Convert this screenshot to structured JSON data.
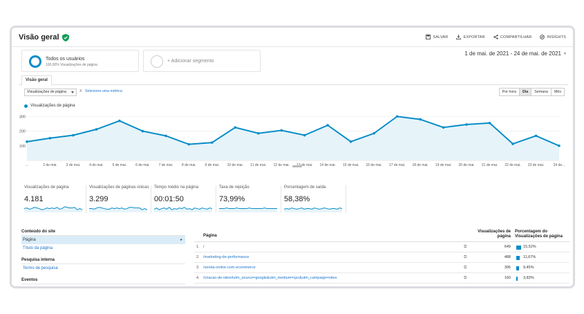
{
  "header": {
    "title": "Visão geral",
    "actions": [
      {
        "label": "SALVAR",
        "icon": "save-icon"
      },
      {
        "label": "EXPORTAR",
        "icon": "download-icon"
      },
      {
        "label": "COMPARTILHAR",
        "icon": "share-icon"
      },
      {
        "label": "INSIGHTS",
        "icon": "insights-icon"
      }
    ]
  },
  "segments": {
    "primary_name": "Todos os usuários",
    "primary_desc": "100,00% Visualizações de página",
    "add_label": "+ Adicionar segmento"
  },
  "date_range": "1 de mai. de 2021 - 24 de mai. de 2021",
  "tabs": [
    "Visão geral"
  ],
  "controls": {
    "metric": "Visualizações de página",
    "vs": "X",
    "select_metric": "Selecione uma métrica",
    "periods": [
      "Por hora",
      "Dia",
      "Semana",
      "Mês"
    ],
    "active_period": "Dia"
  },
  "colors": {
    "accent": "#058dc7",
    "fill": "#e6f3f9",
    "link": "#1a73c8"
  },
  "chart_data": {
    "type": "area",
    "series": [
      {
        "name": "Visualizações de página",
        "values": [
          128,
          152,
          172,
          212,
          270,
          200,
          168,
          110,
          122,
          225,
          185,
          205,
          172,
          240,
          128,
          185,
          300,
          280,
          225,
          245,
          255,
          113,
          168,
          100
        ]
      }
    ],
    "x": [
      "...",
      "2 de mai.",
      "3 de mai.",
      "4 de mai.",
      "5 de mai.",
      "6 de mai.",
      "7 de mai.",
      "8 de mai.",
      "9 de mai.",
      "10 de mai.",
      "11 de mai.",
      "12 de mai.",
      "13 de mai.",
      "14 de mai.",
      "15 de mai.",
      "16 de mai.",
      "17 de mai.",
      "18 de mai.",
      "19 de mai.",
      "20 de mai.",
      "21 de mai.",
      "22 de mai.",
      "23 de mai.",
      "24 de..."
    ],
    "yticks": [
      100,
      200,
      300
    ],
    "ylim": [
      0,
      330
    ],
    "grid": true
  },
  "kpis": [
    {
      "label": "Visualizações de página",
      "value": "4.181",
      "spark": [
        5,
        6,
        4,
        5,
        7,
        6,
        5,
        3,
        4,
        6,
        5,
        6,
        5,
        7,
        4,
        5,
        8,
        7,
        6,
        6,
        7,
        3,
        5,
        3
      ]
    },
    {
      "label": "Visualizações de páginas únicas",
      "value": "3.299",
      "spark": [
        5,
        5,
        4,
        6,
        7,
        6,
        5,
        4,
        4,
        6,
        5,
        6,
        5,
        6,
        4,
        5,
        7,
        7,
        6,
        6,
        6,
        3,
        5,
        3
      ]
    },
    {
      "label": "Tempo médio na página",
      "value": "00:01:50",
      "spark": [
        4,
        6,
        3,
        5,
        6,
        4,
        7,
        3,
        5,
        4,
        6,
        5,
        7,
        4,
        5,
        3,
        6,
        5,
        4,
        6,
        5,
        4,
        6,
        5
      ]
    },
    {
      "label": "Taxa de rejeição",
      "value": "73,99%",
      "spark": [
        5,
        5,
        5,
        6,
        5,
        5,
        5,
        6,
        5,
        5,
        5,
        5,
        6,
        5,
        5,
        5,
        5,
        5,
        6,
        5,
        5,
        5,
        5,
        5
      ]
    },
    {
      "label": "Porcentagem de saída",
      "value": "58,38%",
      "spark": [
        4,
        5,
        4,
        6,
        5,
        4,
        5,
        6,
        4,
        5,
        5,
        4,
        6,
        5,
        4,
        5,
        6,
        5,
        4,
        5,
        5,
        4,
        6,
        5
      ]
    }
  ],
  "sidebar": {
    "sections": [
      {
        "heading": "Conteúdo do site",
        "items": [
          "Página",
          "Título da página"
        ]
      },
      {
        "heading": "Pesquisa interna",
        "items": [
          "Termo de pesquisa"
        ]
      },
      {
        "heading": "Eventos",
        "items": []
      }
    ],
    "active_item": "Página"
  },
  "table": {
    "headers": {
      "page": "Página",
      "views": "Visualizações de página",
      "pct": "Porcentagem do Visualizações de página"
    },
    "rows": [
      {
        "n": "1.",
        "page": "/",
        "views": "649",
        "pct": "15,52%",
        "share": 15.52
      },
      {
        "n": "2.",
        "page": "/marketing-de-performance",
        "views": "488",
        "pct": "11,67%",
        "share": 11.67
      },
      {
        "n": "3.",
        "page": "/venda-online-com-ecommerce",
        "views": "395",
        "pct": "9,45%",
        "share": 9.45
      },
      {
        "n": "4.",
        "page": "/criacao-de-sites#utm_source=google&utm_medium=cpc&utm_campaign=sites",
        "views": "160",
        "pct": "3,83%",
        "share": 3.83
      }
    ]
  }
}
